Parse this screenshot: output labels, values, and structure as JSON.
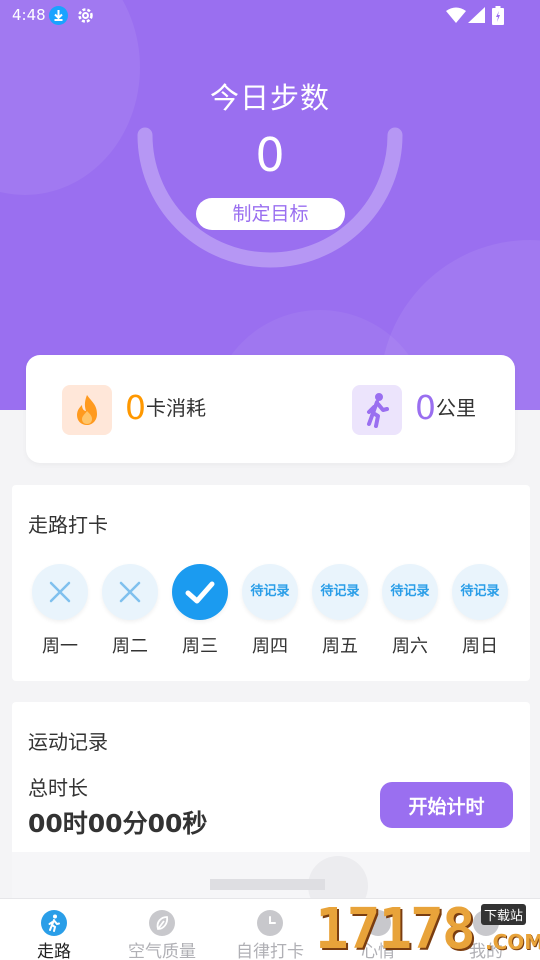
{
  "status_bar": {
    "time": "4:48",
    "icons": [
      "download-icon",
      "gear-icon",
      "wifi-icon",
      "signal-icon",
      "battery-icon"
    ]
  },
  "steps": {
    "title": "今日步数",
    "value": "0",
    "goal_button": "制定目标"
  },
  "stats": {
    "calories": {
      "value": "0",
      "unit": "卡消耗",
      "icon": "fire-icon",
      "color": "#ff9800"
    },
    "distance": {
      "value": "0",
      "unit": "公里",
      "icon": "walking-person-icon",
      "color": "#9a6ff0"
    }
  },
  "checkin": {
    "title": "走路打卡",
    "days": [
      {
        "label": "周一",
        "state": "missed",
        "text": ""
      },
      {
        "label": "周二",
        "state": "missed",
        "text": ""
      },
      {
        "label": "周三",
        "state": "done",
        "text": ""
      },
      {
        "label": "周四",
        "state": "pending",
        "text": "待记录"
      },
      {
        "label": "周五",
        "state": "pending",
        "text": "待记录"
      },
      {
        "label": "周六",
        "state": "pending",
        "text": "待记录"
      },
      {
        "label": "周日",
        "state": "pending",
        "text": "待记录"
      }
    ]
  },
  "record": {
    "title": "运动记录",
    "total_label": "总时长",
    "total_value": "00时00分00秒",
    "start_button": "开始计时"
  },
  "tabs": [
    {
      "label": "走路",
      "icon": "walking-icon",
      "active": true
    },
    {
      "label": "空气质量",
      "icon": "leaf-icon",
      "active": false
    },
    {
      "label": "自律打卡",
      "icon": "clock-icon",
      "active": false
    },
    {
      "label": "心情",
      "icon": "mood-icon",
      "active": false
    },
    {
      "label": "我的",
      "icon": "profile-icon",
      "active": false
    }
  ],
  "watermark": {
    "number": "17178",
    "site": "下载站",
    "domain": ".COM"
  },
  "colors": {
    "primary": "#9a6ff0",
    "accent_blue": "#1b9bf0",
    "calorie_orange": "#ff9800"
  }
}
